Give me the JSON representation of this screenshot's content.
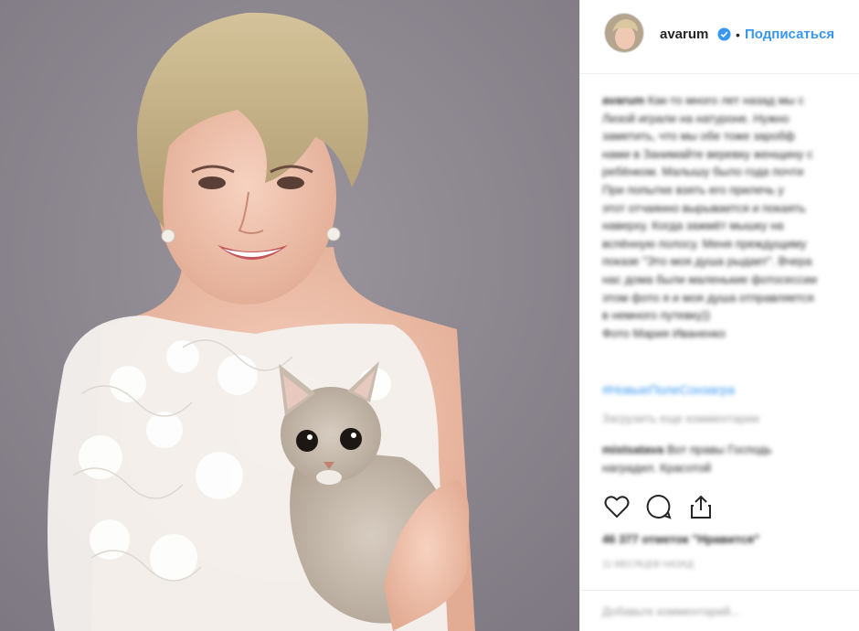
{
  "post": {
    "username": "avarum",
    "verified_icon": "verified-badge-icon",
    "separator": "•",
    "follow_label": "Подписаться",
    "caption_user": "avarum",
    "caption_text": " Как-то много лет назад мы с\nЛизой играли на натуроне. Нужно\nзаметить, что мы обе тоже заробф\nнами в Занимайте веревку женщину с\nребёнком. Малышу было года почти\nПри попытке взять его прилечь у\nэтот отчаянно вырывается и покаять\nнаверху. Когда зажмёт мышку на\nвспённую полосу. Меня преждущиму\nпоказе \"Это моя душа рыдает\". Вчера\nнас дома были маленькие фотосессии\nэтом фото я и моя душа отправляется\nв немного путевку))\nФото Мария Иваненко",
    "hashtag": "#НовыеПолеСонзагра",
    "view_more_comments": "Загрузить еще комментарии",
    "comment_user": "mistsatava",
    "comment_text": " Вот правы Господь\nнаградил. Красотой",
    "likes": "46 377 отметок \"Нравится\"",
    "time_ago": "11 месяцев назад",
    "add_comment_placeholder": "Добавьте комментарий...",
    "icons": [
      "heart-icon",
      "comment-icon",
      "share-icon"
    ]
  },
  "colors": {
    "link_blue": "#3897f0",
    "text_dark": "#262626",
    "muted_gray": "#999999",
    "background_purple_gray": "#8e8892"
  }
}
